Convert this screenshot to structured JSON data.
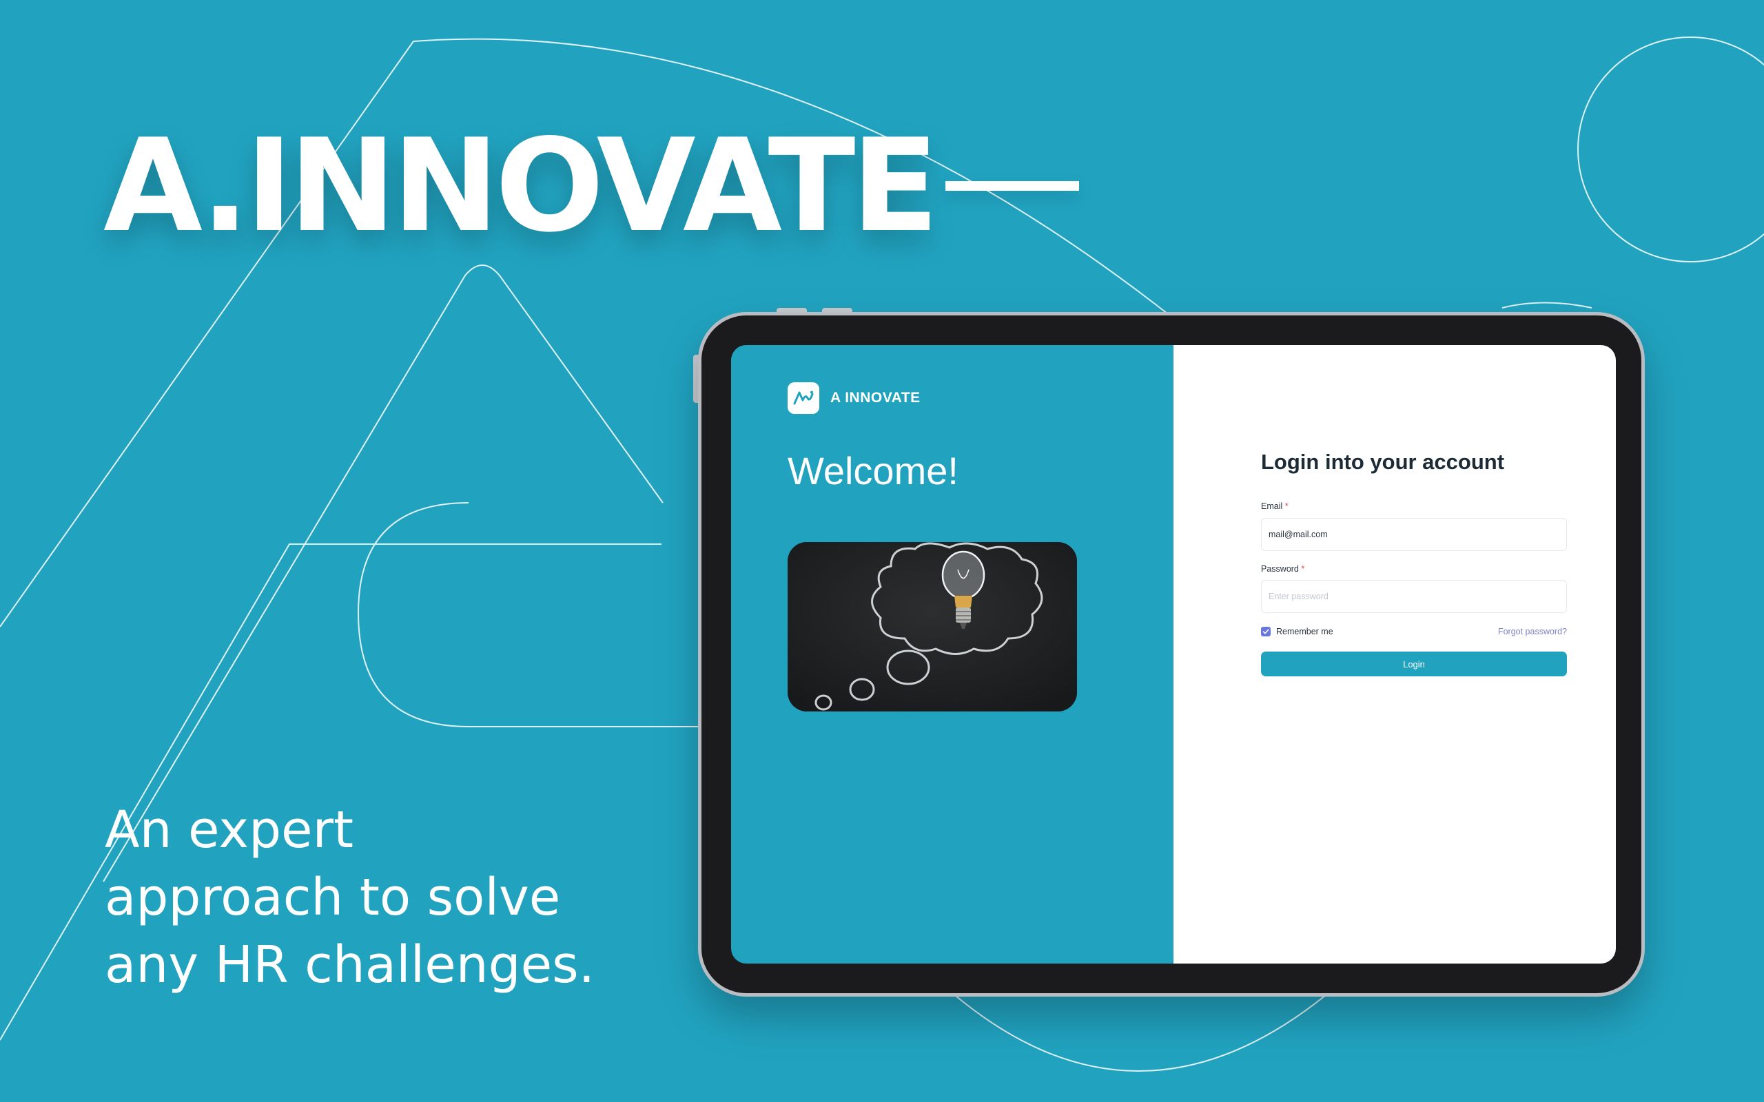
{
  "hero": {
    "title": "A.INNOVATE",
    "tagline": [
      "An expert",
      "approach to solve",
      "any HR challenges."
    ]
  },
  "app": {
    "brand_name": "A INNOVATE",
    "welcome": "Welcome!",
    "login": {
      "title": "Login into your account",
      "email_label": "Email",
      "email_value": "mail@mail.com",
      "password_label": "Password",
      "password_placeholder": "Enter password",
      "required_mark": "*",
      "remember_label": "Remember me",
      "remember_checked": true,
      "forgot_label": "Forgot password?",
      "submit_label": "Login"
    }
  },
  "colors": {
    "background": "#21a3c0",
    "accent": "#21a3c0",
    "checkbox": "#6a78d8",
    "link": "#7c83c9",
    "title": "#1c2b36"
  },
  "icons": [
    "brand-logo-icon",
    "checkmark-icon",
    "lightbulb-icon"
  ]
}
